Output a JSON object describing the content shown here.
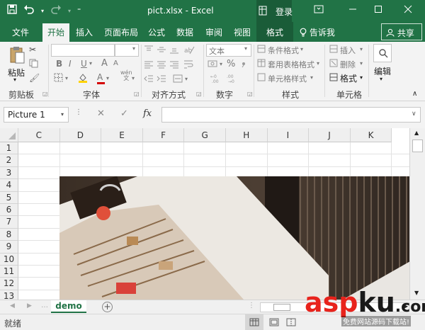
{
  "titlebar": {
    "title": "pict.xlsx  -  Excel",
    "context_tab_icon": "table-tools-icon",
    "login": "登录",
    "save_icon": "save-icon",
    "undo_icon": "undo-icon",
    "redo_icon": "redo-icon",
    "customize_icon": "customize-qat-icon",
    "ribbon_display_icon": "ribbon-display-icon",
    "minimize_icon": "minimize-icon",
    "maximize_icon": "maximize-icon",
    "close_icon": "close-icon"
  },
  "tabs": {
    "file": "文件",
    "home": "开始",
    "insert": "插入",
    "page_layout": "页面布局",
    "formulas": "公式",
    "data": "数据",
    "review": "审阅",
    "view": "视图",
    "format": "格式",
    "tell_me": "告诉我",
    "share": "共享"
  },
  "ribbon": {
    "clipboard": {
      "paste": "粘贴",
      "label": "剪贴板"
    },
    "font": {
      "label": "字体",
      "bold": "B",
      "italic": "I",
      "underline": "U",
      "font_grow": "A",
      "font_shrink": "A",
      "wen": "wén\n文"
    },
    "alignment": {
      "label": "对齐方式"
    },
    "number": {
      "format_value": "文本",
      "percent": "%",
      "label": "数字"
    },
    "styles": {
      "conditional": "条件格式",
      "table_format": "套用表格格式",
      "cell_styles": "单元格样式",
      "label": "样式"
    },
    "cells": {
      "insert": "插入",
      "delete": "删除",
      "format": "格式",
      "label": "单元格"
    },
    "editing": {
      "label": "编辑"
    }
  },
  "formula_bar": {
    "name_box": "Picture 1",
    "cancel": "✕",
    "enter": "✓",
    "fx": "fx",
    "value": ""
  },
  "grid": {
    "columns": [
      "C",
      "D",
      "E",
      "F",
      "G",
      "H",
      "I",
      "J",
      "K"
    ],
    "rows": [
      "1",
      "2",
      "3",
      "4",
      "5",
      "6",
      "7",
      "8",
      "9",
      "10",
      "11",
      "12",
      "13"
    ]
  },
  "sheets": {
    "active": "demo",
    "add": "+"
  },
  "status": {
    "ready": "就绪"
  },
  "watermark": {
    "text_a": "asp",
    "text_b": "ku",
    "text_c": ".com",
    "sub": "免费网站源码下载站!",
    "color_a": "#e8231c",
    "color_b": "#1a1a1a"
  },
  "colors": {
    "accent": "#217346"
  }
}
